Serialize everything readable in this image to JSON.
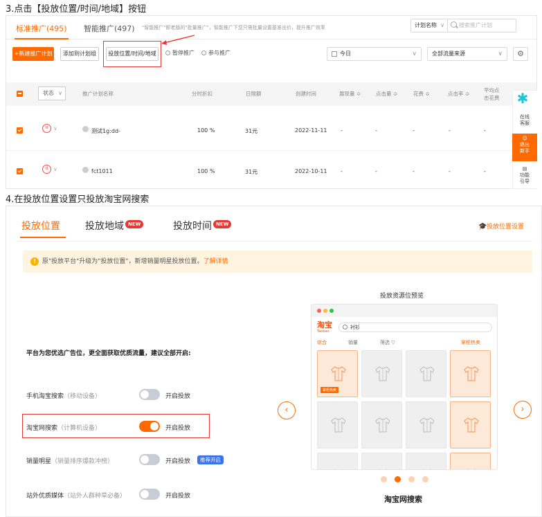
{
  "step3": {
    "title": "3.点击【投放位置/时间/地域】按钮"
  },
  "step4": {
    "title": "4.在投放位置设置只投放淘宝网搜索"
  },
  "panel1": {
    "tabs": [
      {
        "label": "标准推广(495)",
        "active": true
      },
      {
        "label": "智能推广(497)",
        "active": false
      }
    ],
    "tab_note": "\"智能推广\"即老版的\"批量推广\"，智能推广下您只需批量设置基准出价，提升推广效率",
    "plan_select": "计划名称",
    "search_placeholder": "搜索推广计划",
    "toolbar": {
      "new_plan": "+新建推广计划",
      "add_group": "添加到计划组",
      "position_time_region": "投放位置/时间/地域",
      "pause": "暂停推广",
      "promote": "参与推广"
    },
    "date_select": "今日",
    "traffic_select": "全部流量来源",
    "table": {
      "status_filter": "状态",
      "headers": {
        "name": "推广计划名称",
        "discount": "分时折扣",
        "budget": "日限额",
        "created": "创建时间",
        "impressions": "展现量 ≎",
        "clicks": "点击量 ≎",
        "cost": "花费 ≎",
        "ctr": "点击率 ≎",
        "avg_cost_1": "平均点",
        "avg_cost_2": "击花费"
      },
      "rows": [
        {
          "name": "测试1g:dd-",
          "discount": "100 %",
          "budget": "31元",
          "created": "2022-11-11",
          "impressions": "-",
          "clicks": "-",
          "cost": "-",
          "ctr": "-",
          "avg": "-"
        },
        {
          "name": "fct1011",
          "discount": "100 %",
          "budget": "31元",
          "created": "2022-10-11",
          "impressions": "-",
          "clicks": "-",
          "cost": "-",
          "ctr": "-",
          "avg": "-"
        }
      ]
    },
    "float_bar": {
      "online_1": "在线",
      "online_2": "客服",
      "exit_1": "退出",
      "exit_2": "新手",
      "guide_1": "功能",
      "guide_2": "引导"
    }
  },
  "panel2": {
    "tabs": {
      "position": "投放位置",
      "region": "投放地域",
      "time": "投放时间",
      "new_badge": "NEW"
    },
    "settings_link": "投放位置设置",
    "notice": {
      "text": "原\"投放平台\"升级为\"投放位置\"，新增销量明星投放位置。",
      "link": "了解详情"
    },
    "recommend_text": "平台为您优选广告位，更全面获取优质流量，建议全部开启:",
    "positions": [
      {
        "name": "手机淘宝搜索",
        "device": "（移动设备）",
        "enabled": false,
        "toggle_label": "开启投放",
        "badge": ""
      },
      {
        "name": "淘宝网搜索",
        "device": "（计算机设备）",
        "enabled": true,
        "toggle_label": "开启投放",
        "badge": ""
      },
      {
        "name": "销量明星",
        "device": "（销量排序爆款冲榜）",
        "enabled": false,
        "toggle_label": "开启投放",
        "badge": "推荐开启"
      },
      {
        "name": "站外优质媒体",
        "device": "（站外人群种草必备）",
        "enabled": false,
        "toggle_label": "开启投放",
        "badge": ""
      }
    ],
    "preview": {
      "title": "投放资源位预览",
      "logo": "淘宝",
      "logo_en": "Taobao",
      "search_value": "衬衫",
      "tabs": [
        "综合",
        "销量",
        "筛选 ▽",
        "掌柜热卖"
      ],
      "cell_tag": "掌柜热卖",
      "caption": "淘宝网搜索",
      "active_dot": 2
    },
    "colors": {
      "accent": "#ff6a00",
      "highlight": "#e53935",
      "badge_blue": "#3b74e8"
    }
  }
}
